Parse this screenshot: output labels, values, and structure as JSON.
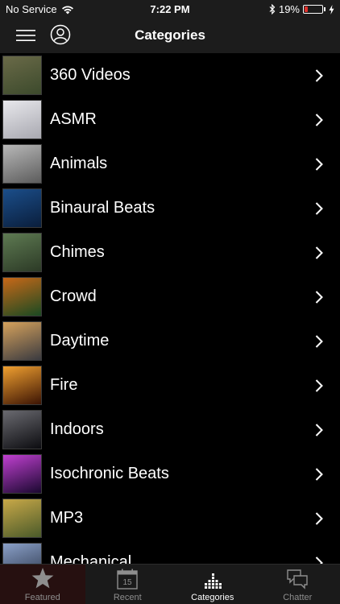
{
  "status": {
    "carrier": "No Service",
    "time": "7:22 PM",
    "battery_percent": "19%",
    "battery_level": 0.19
  },
  "header": {
    "title": "Categories"
  },
  "categories": [
    {
      "label": "360 Videos",
      "thumb": [
        "#6a6a48",
        "#3c4a2c"
      ]
    },
    {
      "label": "ASMR",
      "thumb": [
        "#e8e8ec",
        "#a8a8b0"
      ]
    },
    {
      "label": "Animals",
      "thumb": [
        "#b8b8b8",
        "#5c5c5c"
      ]
    },
    {
      "label": "Binaural Beats",
      "thumb": [
        "#1b4e8a",
        "#0a1e3c"
      ]
    },
    {
      "label": "Chimes",
      "thumb": [
        "#5e7a52",
        "#2c3a26"
      ]
    },
    {
      "label": "Crowd",
      "thumb": [
        "#c86818",
        "#1a4a22"
      ]
    },
    {
      "label": "Daytime",
      "thumb": [
        "#d6a25c",
        "#3a3a40"
      ]
    },
    {
      "label": "Fire",
      "thumb": [
        "#f0a030",
        "#3c1404"
      ]
    },
    {
      "label": "Indoors",
      "thumb": [
        "#6a6a70",
        "#0c0c10"
      ]
    },
    {
      "label": "Isochronic Beats",
      "thumb": [
        "#c040d0",
        "#1a0830"
      ]
    },
    {
      "label": "MP3",
      "thumb": [
        "#c8a848",
        "#4a5a2a"
      ]
    },
    {
      "label": "Mechanical",
      "thumb": [
        "#8aa0c8",
        "#2a3448"
      ]
    }
  ],
  "tabs": [
    {
      "label": "Featured",
      "icon": "star-icon"
    },
    {
      "label": "Recent",
      "icon": "calendar-icon",
      "badge": "15"
    },
    {
      "label": "Categories",
      "icon": "bars-icon"
    },
    {
      "label": "Chatter",
      "icon": "chat-bubbles-icon"
    }
  ],
  "colors": {
    "active_tab": "#ffffff",
    "inactive_tab": "#8e8e8e",
    "battery_low": "#e0312c"
  }
}
